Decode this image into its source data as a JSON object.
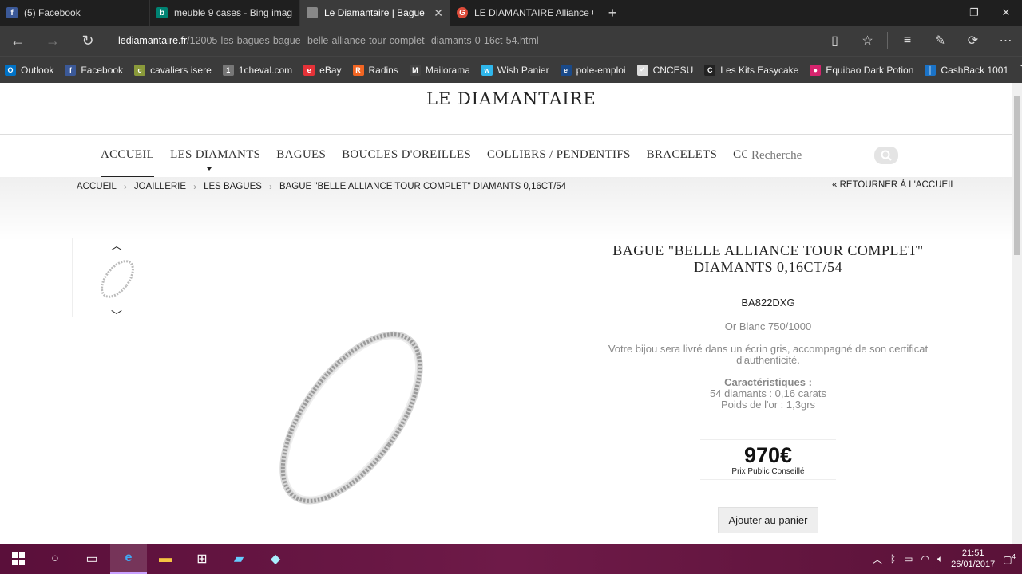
{
  "tabs": [
    {
      "title": "(5) Facebook",
      "icon": "facebook-icon",
      "color": "#3b5998",
      "active": false
    },
    {
      "title": "meuble 9 cases - Bing imag",
      "icon": "bing-icon",
      "color": "#008373",
      "active": false
    },
    {
      "title": "Le Diamantaire | Bague",
      "icon": "page-icon",
      "color": "#888888",
      "active": true
    },
    {
      "title": "LE DIAMANTAIRE Alliance C",
      "icon": "google-icon",
      "color": "#dd4b39",
      "active": false
    }
  ],
  "address": {
    "domain": "lediamantaire.fr",
    "path": "/12005-les-bagues-bague--belle-alliance-tour-complet--diamants-0-16ct-54.html"
  },
  "favorites": [
    {
      "label": "Outlook",
      "color": "#0072c6",
      "glyph": "O"
    },
    {
      "label": "Facebook",
      "color": "#3b5998",
      "glyph": "f"
    },
    {
      "label": "cavaliers isere",
      "color": "#8a9a3a",
      "glyph": "c"
    },
    {
      "label": "1cheval.com",
      "color": "#777777",
      "glyph": "1"
    },
    {
      "label": "eBay",
      "color": "#e53238",
      "glyph": "e"
    },
    {
      "label": "Radins",
      "color": "#f26522",
      "glyph": "R"
    },
    {
      "label": "Mailorama",
      "color": "#444444",
      "glyph": "M"
    },
    {
      "label": "Wish Panier",
      "color": "#2fb7ec",
      "glyph": "w"
    },
    {
      "label": "pole-emploi",
      "color": "#1a4a8a",
      "glyph": "e"
    },
    {
      "label": "CNCESU",
      "color": "#dddddd",
      "glyph": "✓"
    },
    {
      "label": "Les Kits Easycake",
      "color": "#222222",
      "glyph": "C"
    },
    {
      "label": "Equibao Dark Potion",
      "color": "#d6246e",
      "glyph": "●"
    },
    {
      "label": "CashBack 1001",
      "color": "#1a73c8",
      "glyph": "│"
    }
  ],
  "site": {
    "logo": "LE DIAMANTAIRE",
    "menu": [
      "ACCUEIL",
      "LES DIAMANTS",
      "BAGUES",
      "BOUCLES D'OREILLES",
      "COLLIERS / PENDENTIFS",
      "BRACELETS",
      "CONTACT"
    ],
    "search_placeholder": "Recherche",
    "breadcrumbs": [
      "ACCUEIL",
      "JOAILLERIE",
      "LES BAGUES",
      "BAGUE \"BELLE ALLIANCE TOUR COMPLET\" DIAMANTS 0,16CT/54"
    ],
    "back_label": "« RETOURNER À L'ACCUEIL"
  },
  "product": {
    "title_line1": "BAGUE \"BELLE ALLIANCE TOUR COMPLET\"",
    "title_line2": "DIAMANTS 0,16CT/54",
    "reference": "BA822DXG",
    "metal": "Or Blanc 750/1000",
    "description": "Votre bijou sera livré dans un écrin gris, accompagné de son certificat d'authenticité.",
    "features_title": "Caractéristiques :",
    "features": [
      "54 diamants : 0,16 carats",
      "Poids de l'or : 1,3grs"
    ],
    "price": "970€",
    "price_note": "Prix Public Conseillé",
    "cart_button": "Ajouter au panier"
  },
  "taskbar": {
    "time": "21:51",
    "date": "26/01/2017",
    "notifications": "4"
  }
}
